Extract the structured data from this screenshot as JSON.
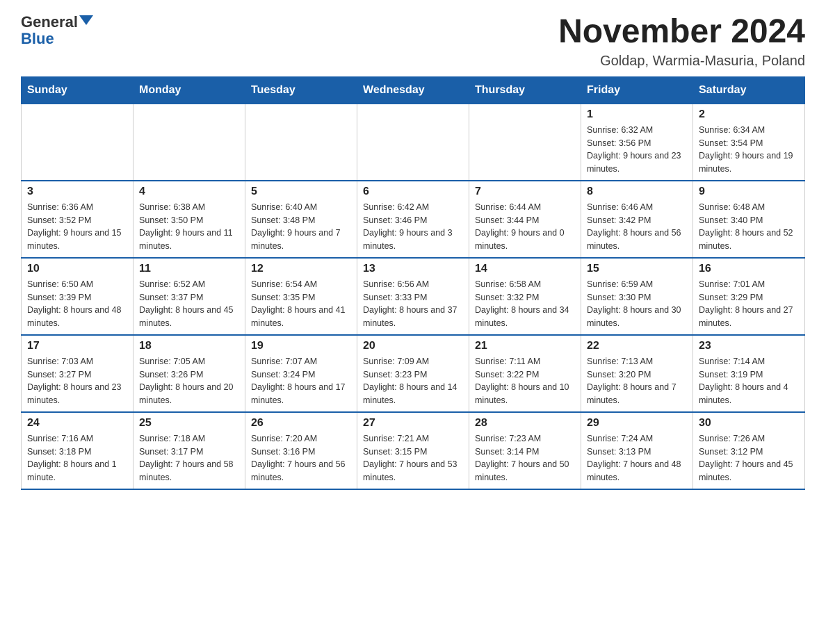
{
  "logo": {
    "text_general": "General",
    "text_blue": "Blue"
  },
  "title": "November 2024",
  "subtitle": "Goldap, Warmia-Masuria, Poland",
  "days_of_week": [
    "Sunday",
    "Monday",
    "Tuesday",
    "Wednesday",
    "Thursday",
    "Friday",
    "Saturday"
  ],
  "weeks": [
    [
      {
        "day": "",
        "info": ""
      },
      {
        "day": "",
        "info": ""
      },
      {
        "day": "",
        "info": ""
      },
      {
        "day": "",
        "info": ""
      },
      {
        "day": "",
        "info": ""
      },
      {
        "day": "1",
        "info": "Sunrise: 6:32 AM\nSunset: 3:56 PM\nDaylight: 9 hours and 23 minutes."
      },
      {
        "day": "2",
        "info": "Sunrise: 6:34 AM\nSunset: 3:54 PM\nDaylight: 9 hours and 19 minutes."
      }
    ],
    [
      {
        "day": "3",
        "info": "Sunrise: 6:36 AM\nSunset: 3:52 PM\nDaylight: 9 hours and 15 minutes."
      },
      {
        "day": "4",
        "info": "Sunrise: 6:38 AM\nSunset: 3:50 PM\nDaylight: 9 hours and 11 minutes."
      },
      {
        "day": "5",
        "info": "Sunrise: 6:40 AM\nSunset: 3:48 PM\nDaylight: 9 hours and 7 minutes."
      },
      {
        "day": "6",
        "info": "Sunrise: 6:42 AM\nSunset: 3:46 PM\nDaylight: 9 hours and 3 minutes."
      },
      {
        "day": "7",
        "info": "Sunrise: 6:44 AM\nSunset: 3:44 PM\nDaylight: 9 hours and 0 minutes."
      },
      {
        "day": "8",
        "info": "Sunrise: 6:46 AM\nSunset: 3:42 PM\nDaylight: 8 hours and 56 minutes."
      },
      {
        "day": "9",
        "info": "Sunrise: 6:48 AM\nSunset: 3:40 PM\nDaylight: 8 hours and 52 minutes."
      }
    ],
    [
      {
        "day": "10",
        "info": "Sunrise: 6:50 AM\nSunset: 3:39 PM\nDaylight: 8 hours and 48 minutes."
      },
      {
        "day": "11",
        "info": "Sunrise: 6:52 AM\nSunset: 3:37 PM\nDaylight: 8 hours and 45 minutes."
      },
      {
        "day": "12",
        "info": "Sunrise: 6:54 AM\nSunset: 3:35 PM\nDaylight: 8 hours and 41 minutes."
      },
      {
        "day": "13",
        "info": "Sunrise: 6:56 AM\nSunset: 3:33 PM\nDaylight: 8 hours and 37 minutes."
      },
      {
        "day": "14",
        "info": "Sunrise: 6:58 AM\nSunset: 3:32 PM\nDaylight: 8 hours and 34 minutes."
      },
      {
        "day": "15",
        "info": "Sunrise: 6:59 AM\nSunset: 3:30 PM\nDaylight: 8 hours and 30 minutes."
      },
      {
        "day": "16",
        "info": "Sunrise: 7:01 AM\nSunset: 3:29 PM\nDaylight: 8 hours and 27 minutes."
      }
    ],
    [
      {
        "day": "17",
        "info": "Sunrise: 7:03 AM\nSunset: 3:27 PM\nDaylight: 8 hours and 23 minutes."
      },
      {
        "day": "18",
        "info": "Sunrise: 7:05 AM\nSunset: 3:26 PM\nDaylight: 8 hours and 20 minutes."
      },
      {
        "day": "19",
        "info": "Sunrise: 7:07 AM\nSunset: 3:24 PM\nDaylight: 8 hours and 17 minutes."
      },
      {
        "day": "20",
        "info": "Sunrise: 7:09 AM\nSunset: 3:23 PM\nDaylight: 8 hours and 14 minutes."
      },
      {
        "day": "21",
        "info": "Sunrise: 7:11 AM\nSunset: 3:22 PM\nDaylight: 8 hours and 10 minutes."
      },
      {
        "day": "22",
        "info": "Sunrise: 7:13 AM\nSunset: 3:20 PM\nDaylight: 8 hours and 7 minutes."
      },
      {
        "day": "23",
        "info": "Sunrise: 7:14 AM\nSunset: 3:19 PM\nDaylight: 8 hours and 4 minutes."
      }
    ],
    [
      {
        "day": "24",
        "info": "Sunrise: 7:16 AM\nSunset: 3:18 PM\nDaylight: 8 hours and 1 minute."
      },
      {
        "day": "25",
        "info": "Sunrise: 7:18 AM\nSunset: 3:17 PM\nDaylight: 7 hours and 58 minutes."
      },
      {
        "day": "26",
        "info": "Sunrise: 7:20 AM\nSunset: 3:16 PM\nDaylight: 7 hours and 56 minutes."
      },
      {
        "day": "27",
        "info": "Sunrise: 7:21 AM\nSunset: 3:15 PM\nDaylight: 7 hours and 53 minutes."
      },
      {
        "day": "28",
        "info": "Sunrise: 7:23 AM\nSunset: 3:14 PM\nDaylight: 7 hours and 50 minutes."
      },
      {
        "day": "29",
        "info": "Sunrise: 7:24 AM\nSunset: 3:13 PM\nDaylight: 7 hours and 48 minutes."
      },
      {
        "day": "30",
        "info": "Sunrise: 7:26 AM\nSunset: 3:12 PM\nDaylight: 7 hours and 45 minutes."
      }
    ]
  ]
}
